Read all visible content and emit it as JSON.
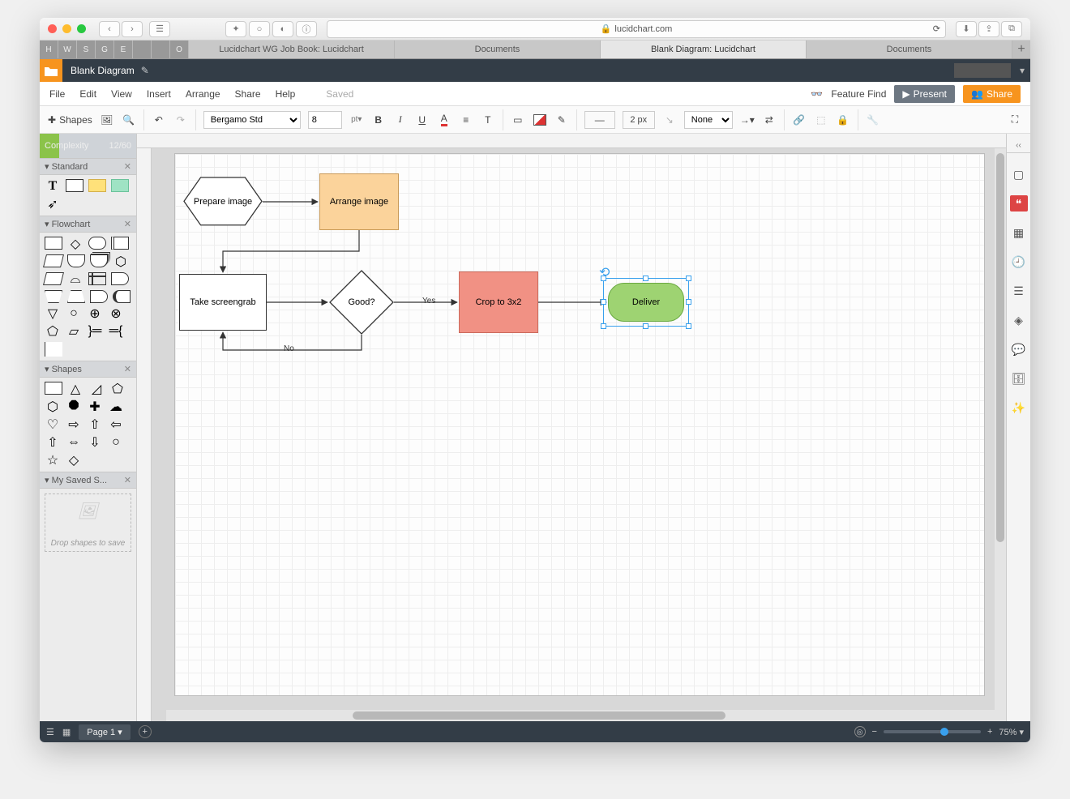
{
  "browser": {
    "url": "lucidchart.com",
    "tabs": [
      "Lucidchart WG Job Book: Lucidchart",
      "Documents",
      "Blank Diagram: Lucidchart",
      "Documents"
    ],
    "activeTab": 2,
    "pinned": [
      "H",
      "W",
      "S",
      "G",
      "E",
      "",
      "",
      "O"
    ]
  },
  "app": {
    "docTitle": "Blank Diagram",
    "menus": [
      "File",
      "Edit",
      "View",
      "Insert",
      "Arrange",
      "Share",
      "Help"
    ],
    "saved": "Saved",
    "featureFind": "Feature Find",
    "present": "Present",
    "share": "Share"
  },
  "toolbar": {
    "shapesLabel": "Shapes",
    "font": "Bergamo Std",
    "fontSize": "8",
    "fontUnit": "pt",
    "lineWidth": "2 px",
    "lineEnd": "None"
  },
  "leftPane": {
    "complexityLabel": "Complexity",
    "complexityValue": "12/60",
    "sections": [
      "Standard",
      "Flowchart",
      "Shapes",
      "My Saved S..."
    ],
    "dropHint": "Drop shapes to save"
  },
  "canvas": {
    "nodes": {
      "prepare": "Prepare image",
      "arrange": "Arrange image",
      "screengrab": "Take screengrab",
      "good": "Good?",
      "crop": "Crop to 3x2",
      "deliver": "Deliver"
    },
    "edgeLabels": {
      "yes": "Yes",
      "no": "No"
    }
  },
  "rightRail": {
    "icons": [
      "page-icon",
      "quote-icon",
      "presentation-icon",
      "history-icon",
      "layers-icon",
      "revision-icon",
      "comment-icon",
      "data-icon",
      "magic-icon"
    ]
  },
  "bottom": {
    "page": "Page 1",
    "zoom": "75%"
  }
}
